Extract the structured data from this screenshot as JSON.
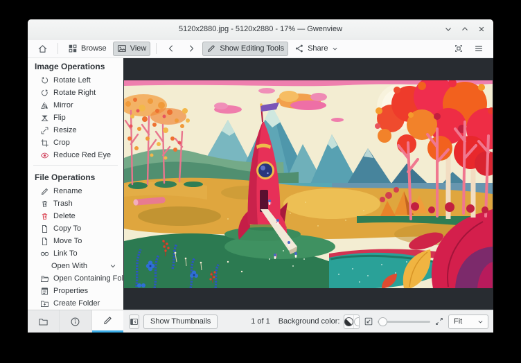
{
  "window": {
    "title": "5120x2880.jpg - 5120x2880 - 17% — Gwenview"
  },
  "toolbar": {
    "browse": "Browse",
    "view": "View",
    "show_editing_tools": "Show Editing Tools",
    "share": "Share"
  },
  "sidebar": {
    "image_operations": {
      "title": "Image Operations",
      "items": [
        {
          "label": "Rotate Left",
          "icon": "rotate-left-icon"
        },
        {
          "label": "Rotate Right",
          "icon": "rotate-right-icon"
        },
        {
          "label": "Mirror",
          "icon": "mirror-icon"
        },
        {
          "label": "Flip",
          "icon": "flip-icon"
        },
        {
          "label": "Resize",
          "icon": "resize-icon"
        },
        {
          "label": "Crop",
          "icon": "crop-icon"
        },
        {
          "label": "Reduce Red Eye",
          "icon": "red-eye-icon"
        }
      ]
    },
    "file_operations": {
      "title": "File Operations",
      "items": [
        {
          "label": "Rename",
          "icon": "rename-icon"
        },
        {
          "label": "Trash",
          "icon": "trash-icon"
        },
        {
          "label": "Delete",
          "icon": "delete-icon"
        },
        {
          "label": "Copy To",
          "icon": "copy-icon"
        },
        {
          "label": "Move To",
          "icon": "move-icon"
        },
        {
          "label": "Link To",
          "icon": "link-icon"
        }
      ],
      "open_with": "Open With",
      "items2": [
        {
          "label": "Open Containing Folder",
          "icon": "folder-open-icon"
        },
        {
          "label": "Properties",
          "icon": "properties-icon"
        },
        {
          "label": "Create Folder",
          "icon": "folder-new-icon"
        }
      ]
    }
  },
  "statusbar": {
    "show_thumbnails": "Show Thumbnails",
    "counter": "1 of 1",
    "background_color_label": "Background color:",
    "background_swatches": {
      "options": [
        "auto",
        "white",
        "gray",
        "black"
      ],
      "selected": "black"
    },
    "zoom_mode": "Fit"
  },
  "image": {
    "alt": "Colorful illustration of a red rocket with a purple flag standing in golden fields, with teal mountains, a pale sun, pink clouds, orange autumn trees, blue plants and a teal pond"
  },
  "colors": {
    "accent": "#3daee9",
    "canvas_background": "#282c31",
    "delete_red": "#da4453"
  }
}
